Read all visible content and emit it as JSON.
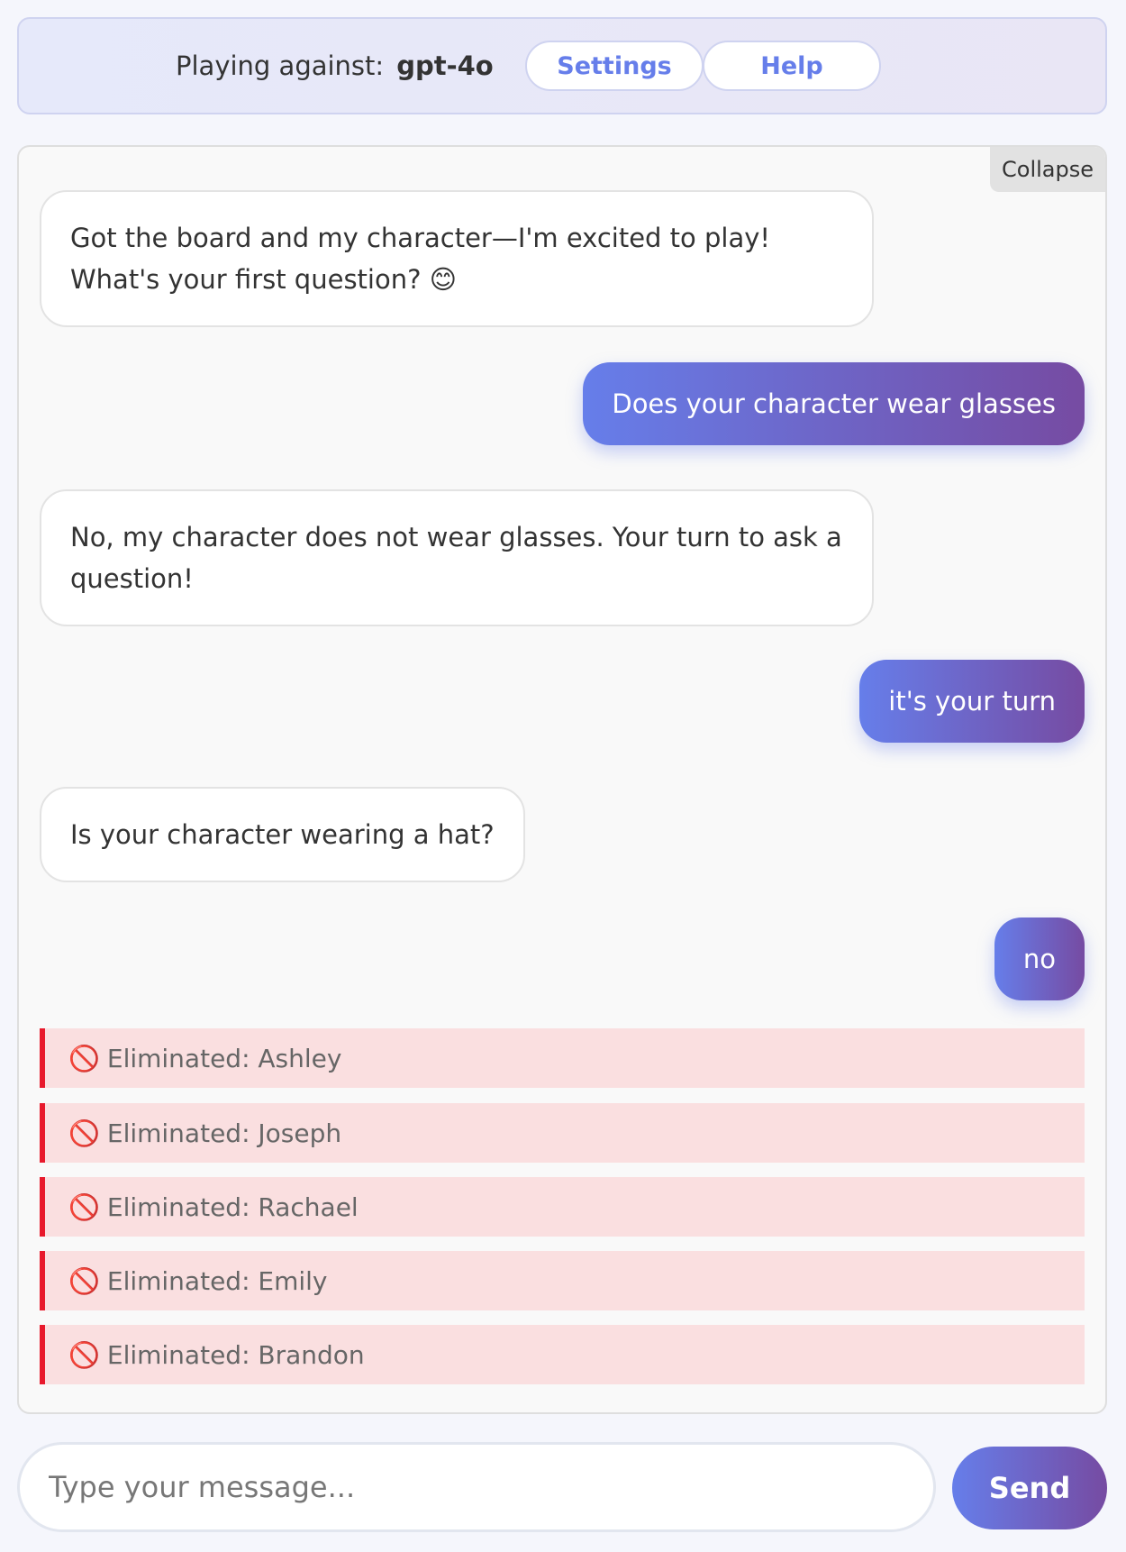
{
  "header": {
    "playing_label": "Playing against:",
    "model": "gpt-4o",
    "settings_label": "Settings",
    "help_label": "Help"
  },
  "chat": {
    "collapse_label": "Collapse",
    "messages": [
      {
        "role": "ai",
        "text": "Got the board and my character—I'm excited to play! What's your first question? 😊"
      },
      {
        "role": "user",
        "text": "Does your character wear glasses"
      },
      {
        "role": "ai",
        "text": "No, my character does not wear glasses. Your turn to ask a question!"
      },
      {
        "role": "user",
        "text": "it's your turn"
      },
      {
        "role": "ai",
        "text": "Is your character wearing a hat?"
      },
      {
        "role": "user",
        "text": "no"
      }
    ],
    "eliminated": [
      "Eliminated: Ashley",
      "Eliminated: Joseph",
      "Eliminated: Rachael",
      "Eliminated: Emily",
      "Eliminated: Brandon"
    ],
    "eliminated_icon": "prohibited-icon"
  },
  "composer": {
    "placeholder": "Type your message...",
    "send_label": "Send"
  },
  "colors": {
    "accent_start": "#667eea",
    "accent_end": "#764ba2",
    "eliminated_bg": "#fadfe0",
    "eliminated_border": "#e8192c"
  }
}
